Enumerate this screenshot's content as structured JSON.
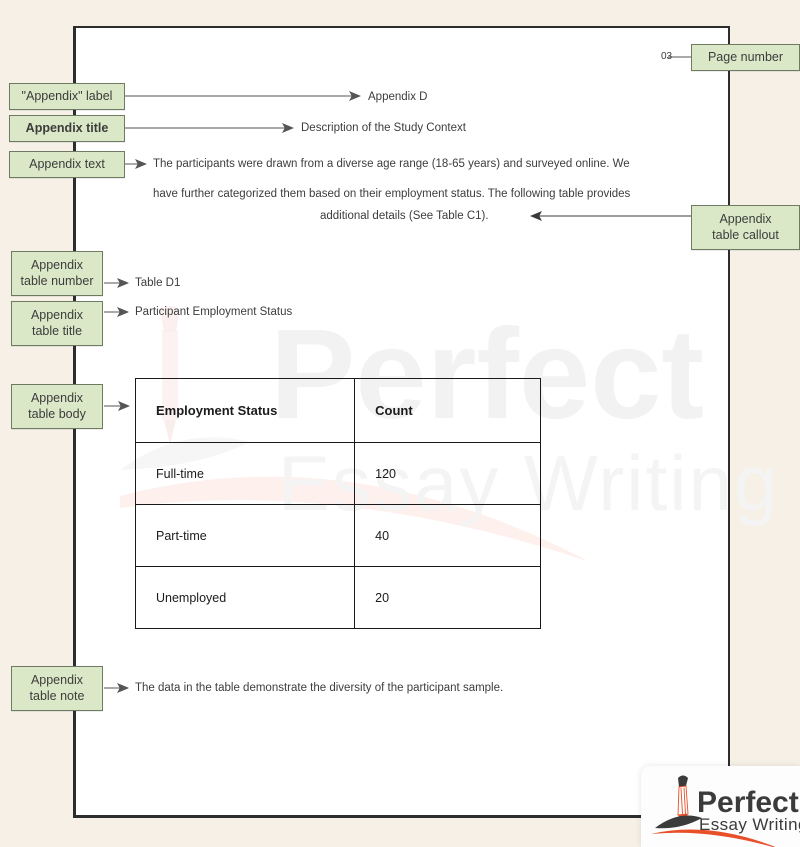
{
  "document": {
    "page_number": "03",
    "appendix_label": "Appendix D",
    "appendix_title": "Description of the Study Context",
    "body_lines": [
      "The participants were drawn from a diverse age range (18-65 years) and surveyed online. We",
      "have further categorized them based on their employment status. The following table provides",
      "additional details (See Table C1)."
    ],
    "table_number": "Table D1",
    "table_title": "Participant Employment Status",
    "table_note": "The data in the table demonstrate the diversity of the participant sample."
  },
  "annotations": {
    "page_number": "Page number",
    "appendix_label": "\"Appendix\" label",
    "appendix_title": "Appendix title",
    "appendix_text": "Appendix text",
    "table_callout": "Appendix\ntable callout",
    "table_callout_line1": "Appendix",
    "table_callout_line2": "table callout",
    "table_number_line1": "Appendix",
    "table_number_line2": "table number",
    "table_title_line1": "Appendix",
    "table_title_line2": "table title",
    "table_body_line1": "Appendix",
    "table_body_line2": "table body",
    "table_note_line1": "Appendix",
    "table_note_line2": "table note"
  },
  "chart_data": {
    "type": "table",
    "title": "Participant Employment Status",
    "columns": [
      "Employment Status",
      "Count"
    ],
    "rows": [
      [
        "Full-time",
        "120"
      ],
      [
        "Part-time",
        "40"
      ],
      [
        "Unemployed",
        "20"
      ]
    ]
  },
  "branding": {
    "logo_primary": "Perfect",
    "logo_secondary": "Essay Writing",
    "watermark_primary": "Perfect",
    "watermark_secondary": "Essay Writing"
  },
  "colors": {
    "tag_fill": "#dbe8c8",
    "tag_border": "#6f7a63",
    "page_bg": "#ffffff",
    "canvas_bg": "#f6f0e7",
    "arrow": "#555555",
    "logo_orange": "#e8502a",
    "logo_dark": "#3b3b3b"
  }
}
